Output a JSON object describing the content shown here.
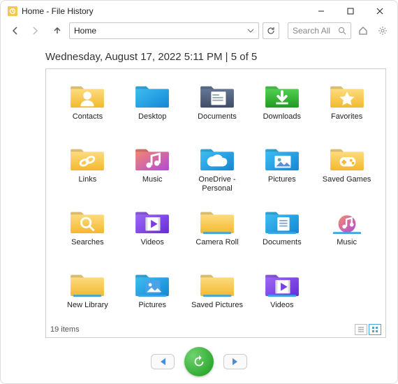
{
  "window": {
    "title": "Home - File History"
  },
  "toolbar": {
    "address": "Home",
    "search_placeholder": "Search All"
  },
  "dateline": "Wednesday, August 17, 2022 5:11 PM   |   5 of 5",
  "status": {
    "count": "19 items"
  },
  "items": [
    {
      "label": "Contacts"
    },
    {
      "label": "Desktop"
    },
    {
      "label": "Documents"
    },
    {
      "label": "Downloads"
    },
    {
      "label": "Favorites"
    },
    {
      "label": "Links"
    },
    {
      "label": "Music"
    },
    {
      "label": "OneDrive - Personal"
    },
    {
      "label": "Pictures"
    },
    {
      "label": "Saved Games"
    },
    {
      "label": "Searches"
    },
    {
      "label": "Videos"
    },
    {
      "label": "Camera Roll"
    },
    {
      "label": "Documents"
    },
    {
      "label": "Music"
    },
    {
      "label": "New Library"
    },
    {
      "label": "Pictures"
    },
    {
      "label": "Saved Pictures"
    },
    {
      "label": "Videos"
    }
  ],
  "icon_map": {
    "Contacts": "contacts",
    "Desktop": "desktop",
    "Documents": "documents",
    "Downloads": "downloads",
    "Favorites": "favorites",
    "Links": "links",
    "Music": "music",
    "OneDrive - Personal": "onedrive",
    "Pictures": "pictures",
    "Saved Games": "games",
    "Searches": "search",
    "Videos": "videos",
    "Camera Roll": "lib-plain",
    "New Library": "lib-plain",
    "Saved Pictures": "lib-plain"
  },
  "library_rows": [
    12,
    13,
    14,
    15,
    16,
    17,
    18
  ]
}
